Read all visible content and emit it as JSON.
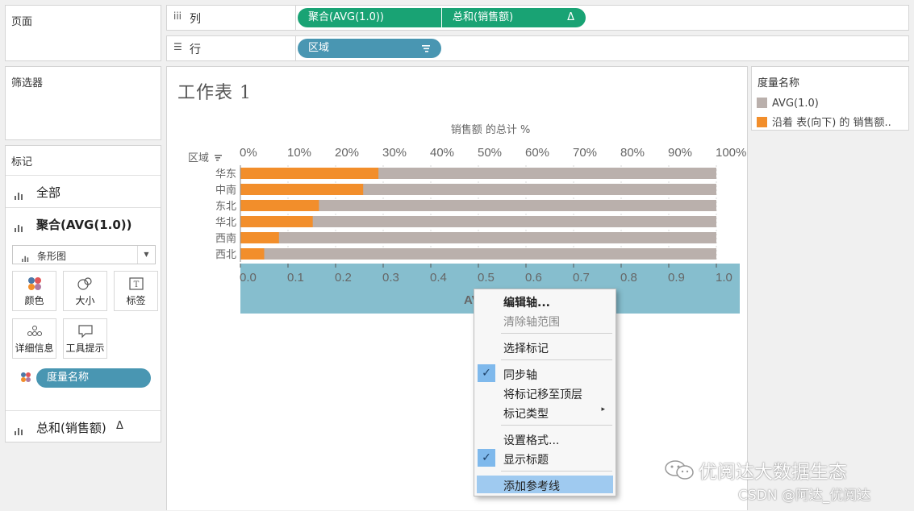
{
  "sidebar": {
    "pages_title": "页面",
    "filters_title": "筛选器",
    "marks_title": "标记",
    "all_label": "全部",
    "agg_label": "聚合(AVG(1.0))",
    "mark_type": "条形图",
    "buttons": {
      "color": "颜色",
      "size": "大小",
      "label": "标签",
      "detail": "详细信息",
      "tooltip": "工具提示"
    },
    "measure_names_pill": "度量名称",
    "sum_label": "总和(销售额)",
    "sum_delta": "Δ"
  },
  "shelves": {
    "columns_label": "列",
    "rows_label": "行",
    "columns_pills": [
      "聚合(AVG(1.0))",
      "总和(销售额)"
    ],
    "columns_delta": "Δ",
    "rows_pill": "区域"
  },
  "sheet": {
    "title": "工作表 1"
  },
  "legend": {
    "title": "度量名称",
    "items": [
      {
        "label": "AVG(1.0)",
        "color": "#bab0ac"
      },
      {
        "label": "沿着 表(向下) 的 销售额..",
        "color": "#f28e2b"
      }
    ]
  },
  "chart_data": {
    "type": "bar",
    "orientation": "horizontal",
    "top_axis_title": "销售额 的总计 %",
    "row_header": "区域",
    "top_ticks": [
      "0%",
      "10%",
      "20%",
      "30%",
      "40%",
      "50%",
      "60%",
      "70%",
      "80%",
      "90%",
      "100%"
    ],
    "bottom_ticks": [
      "0.0",
      "0.1",
      "0.2",
      "0.3",
      "0.4",
      "0.5",
      "0.6",
      "0.7",
      "0.8",
      "0.9",
      "1.0"
    ],
    "bottom_axis_title_partial": "AV",
    "categories": [
      "华东",
      "中南",
      "东北",
      "华北",
      "西南",
      "西北"
    ],
    "series": [
      {
        "name": "AVG(1.0)",
        "color": "#bab0ac",
        "values": [
          1.0,
          1.0,
          1.0,
          1.0,
          1.0,
          1.0
        ]
      },
      {
        "name": "沿着 表(向下) 的 销售额..",
        "color": "#f28e2b",
        "values": [
          0.29,
          0.258,
          0.165,
          0.152,
          0.081,
          0.05
        ]
      }
    ],
    "xlim": [
      0,
      1
    ]
  },
  "context_menu": {
    "items": [
      {
        "label": "编辑轴...",
        "bold": true
      },
      {
        "label": "清除轴范围",
        "disabled": true
      },
      {
        "label": "选择标记"
      },
      {
        "label": "同步轴",
        "checked": true
      },
      {
        "label": "将标记移至顶层"
      },
      {
        "label": "标记类型",
        "submenu": true
      },
      {
        "label": "设置格式..."
      },
      {
        "label": "显示标题",
        "checked": true
      },
      {
        "label": "添加参考线",
        "highlighted": true
      }
    ],
    "check_glyph": "✓",
    "submenu_glyph": "▸"
  },
  "watermark": {
    "line1": "优阅达大数据生态",
    "line2": "CSDN @阿达_优阅达"
  }
}
